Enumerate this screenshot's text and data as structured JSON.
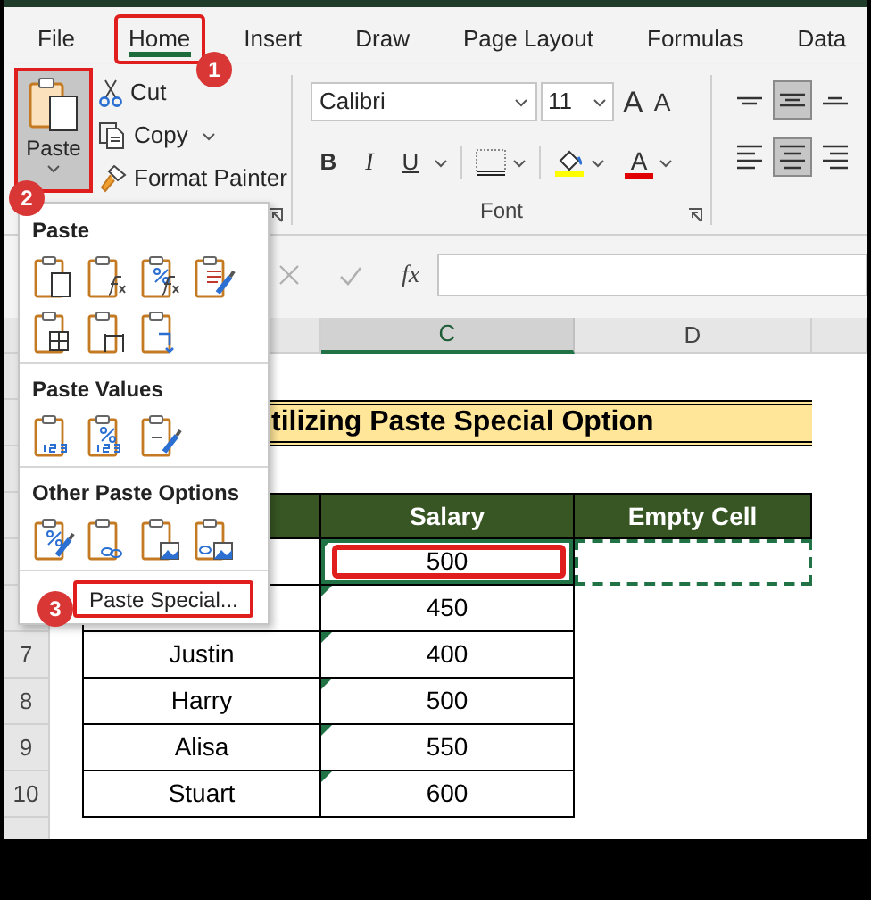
{
  "ribbon_tabs": [
    {
      "label": "File",
      "selected": false,
      "highlighted": false
    },
    {
      "label": "Home",
      "selected": true,
      "highlighted": true
    },
    {
      "label": "Insert",
      "selected": false,
      "highlighted": false
    },
    {
      "label": "Draw",
      "selected": false,
      "highlighted": false
    },
    {
      "label": "Page Layout",
      "selected": false,
      "highlighted": false
    },
    {
      "label": "Formulas",
      "selected": false,
      "highlighted": false
    },
    {
      "label": "Data",
      "selected": false,
      "highlighted": false
    }
  ],
  "clipboard": {
    "paste": {
      "label": "Paste",
      "pressed": true,
      "highlighted": true
    },
    "cut": "Cut",
    "copy": "Copy",
    "format_painter": "Format Painter"
  },
  "font_group": {
    "font_name": "Calibri",
    "font_size": "11",
    "grow": "A",
    "shrink": "A",
    "bold": "B",
    "italic": "I",
    "underline": "U",
    "font_color": "A",
    "label": "Font"
  },
  "alignment": [
    {
      "kind": "top",
      "selected": false
    },
    {
      "kind": "middle",
      "selected": true
    },
    {
      "kind": "bottom",
      "selected": false
    },
    {
      "kind": "left",
      "selected": false
    },
    {
      "kind": "center",
      "selected": true
    },
    {
      "kind": "right",
      "selected": false
    }
  ],
  "formula_bar": {
    "function_button": "fx"
  },
  "column_headers": [
    {
      "label": "C",
      "selected": true
    },
    {
      "label": "D",
      "selected": false
    }
  ],
  "title": "tilizing Paste Special Option",
  "table": {
    "columns": [
      "Salary",
      "Empty Cell"
    ],
    "rows": [
      {
        "salary": "500",
        "selected": true,
        "highlighted": true,
        "marquee": true,
        "flagged": true
      },
      {
        "salary": "450",
        "selected": false,
        "flagged": true
      },
      {
        "row_number": "7",
        "name": "Justin",
        "salary": "400",
        "selected": false,
        "flagged": true
      },
      {
        "row_number": "8",
        "name": "Harry",
        "salary": "500",
        "selected": false,
        "flagged": true
      },
      {
        "row_number": "9",
        "name": "Alisa",
        "salary": "550",
        "selected": false,
        "flagged": true
      },
      {
        "row_number": "10",
        "name": "Stuart",
        "salary": "600",
        "selected": false,
        "flagged": true
      }
    ]
  },
  "paste_menu": {
    "sections": [
      {
        "heading": "Paste",
        "items": [
          {
            "kind": "all"
          },
          {
            "kind": "formulas"
          },
          {
            "kind": "formulas_number"
          },
          {
            "kind": "keep_source"
          },
          {
            "kind": "no_borders"
          },
          {
            "kind": "keep_width"
          },
          {
            "kind": "transpose"
          }
        ]
      },
      {
        "heading": "Paste Values",
        "items": [
          {
            "kind": "values"
          },
          {
            "kind": "values_number"
          },
          {
            "kind": "values_source"
          }
        ]
      },
      {
        "heading": "Other Paste Options",
        "items": [
          {
            "kind": "formatting"
          },
          {
            "kind": "link"
          },
          {
            "kind": "picture"
          },
          {
            "kind": "linked_picture"
          }
        ]
      }
    ],
    "paste_special": {
      "label": "Paste Special...",
      "highlighted": true
    }
  },
  "callouts": [
    {
      "number": "1"
    },
    {
      "number": "2"
    },
    {
      "number": "3"
    }
  ]
}
